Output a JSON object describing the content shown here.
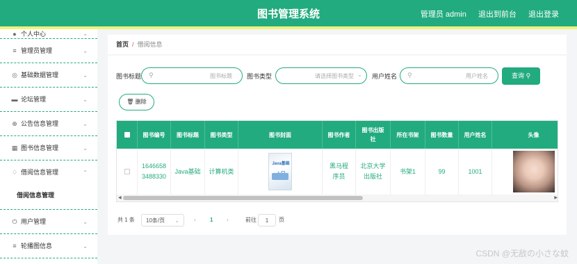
{
  "header": {
    "title": "图书管理系统",
    "user_label": "管理员 admin",
    "back_link": "退出到前台",
    "logout_link": "退出登录"
  },
  "sidebar": {
    "items": [
      {
        "label": "个人中心",
        "icon": "user-icon"
      },
      {
        "label": "管理员管理",
        "icon": "list-icon"
      },
      {
        "label": "基础数据管理",
        "icon": "compass-icon"
      },
      {
        "label": "论坛管理",
        "icon": "monitor-icon"
      },
      {
        "label": "公告信息管理",
        "icon": "crosshair-icon"
      },
      {
        "label": "图书信息管理",
        "icon": "grid-icon"
      },
      {
        "label": "借阅信息管理",
        "icon": "bell-icon"
      },
      {
        "label": "用户管理",
        "icon": "power-icon"
      },
      {
        "label": "轮播图信息",
        "icon": "sliders-icon"
      }
    ],
    "submenu_label": "借阅信息管理"
  },
  "breadcrumb": {
    "home": "首页",
    "separator": "/",
    "current": "借阅信息"
  },
  "filters": {
    "title_label": "图书标题",
    "title_placeholder": "图书标题",
    "type_label": "图书类型",
    "type_placeholder": "请选择图书类型",
    "user_label": "用户姓名",
    "user_placeholder": "用户姓名",
    "search_button": "查询",
    "delete_button": "删除"
  },
  "table": {
    "headers": [
      "图书编号",
      "图书标题",
      "图书类型",
      "图书封面",
      "图书作者",
      "图书出版社",
      "所在书架",
      "图书数量",
      "用户姓名",
      "头像"
    ],
    "rows": [
      {
        "book_id": "1646658 3488330",
        "title": "Java基础",
        "type": "计算机类",
        "cover_text": "Java基础入门",
        "author": "黑马程序员",
        "publisher": "北京大学出版社",
        "shelf": "书架1",
        "count": "99",
        "user_name": "1001"
      }
    ]
  },
  "pagination": {
    "total": "共 1 条",
    "page_size": "10条/页",
    "current_page": "1",
    "goto_label": "前往",
    "goto_value": "1",
    "goto_suffix": "页"
  },
  "watermark": "CSDN @无敌の小さな蚊",
  "colors": {
    "primary": "#22ab7e",
    "header_strip": "#eef37a",
    "breadcrumb_sep": "#e0564c"
  }
}
